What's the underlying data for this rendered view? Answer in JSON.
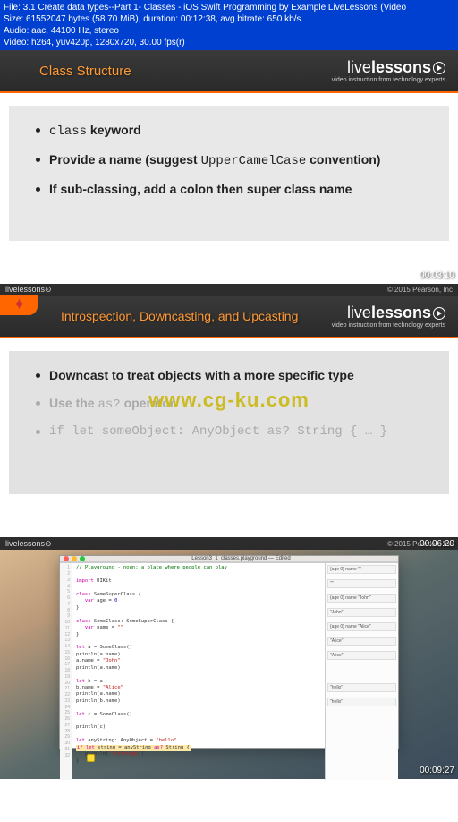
{
  "metadata": {
    "file": "File: 3.1 Create data types--Part 1- Classes - iOS Swift Programming by Example LiveLessons (Video",
    "size": "Size: 61552047 bytes (58.70 MiB), duration: 00:12:38, avg.bitrate: 650 kb/s",
    "audio": "Audio: aac, 44100 Hz, stereo",
    "video": "Video: h264, yuv420p, 1280x720, 30.00 fps(r)"
  },
  "brand": {
    "live": "live",
    "lessons": "lessons",
    "tagline": "video instruction from technology experts"
  },
  "slide1": {
    "title": "Class Structure",
    "bullets": [
      {
        "pre": "",
        "code": "class",
        "post": " keyword"
      },
      {
        "pre": "Provide a name (suggest ",
        "code": "UpperCamelCase",
        "post": " convention)"
      },
      {
        "pre": "If sub-classing, add a colon then super class name",
        "code": "",
        "post": ""
      }
    ]
  },
  "strip2": {
    "copyright": "© 2015 Pearson, Inc",
    "timestamp": "00:03:10"
  },
  "slide2": {
    "title": "Introspection, Downcasting, and Upcasting",
    "bullets": [
      {
        "text": "Downcast to treat objects with a more specific type",
        "gray": false
      },
      {
        "text_pre": "Use the ",
        "code": "as?",
        "text_post": " operator",
        "gray": true
      },
      {
        "code_full": "if let someObject: AnyObject as? String { … }",
        "gray": true
      }
    ],
    "watermark": "www.cg-ku.com"
  },
  "strip3": {
    "copyright": "© 2015 Pearson, Inc",
    "timestamp": "00:06:20"
  },
  "screenshot": {
    "window_title": "Lesson3_1_classes.playground — Edited",
    "timestamp": "00:09:27",
    "line_numbers": "1\n2\n3\n4\n5\n6\n7\n8\n9\n10\n11\n12\n13\n14\n15\n16\n17\n18\n19\n20\n21\n22\n23\n24\n25\n26\n27\n28\n29\n30\n31\n32",
    "code_comment": "// Playground - noun: a place where people can play",
    "code_import": "import",
    "code_uikit": " UIKit",
    "code_l1": "class",
    "code_l1b": " SomeSuperClass {",
    "code_l2": "   var",
    "code_l2b": " age = ",
    "code_l2c": "0",
    "code_l3": "}",
    "code_l4": "class",
    "code_l4b": " SomeClass: SomeSuperClass {",
    "code_l5": "   var",
    "code_l5b": " name = ",
    "code_l5c": "\"\"",
    "code_l6": "}",
    "code_l7": "let",
    "code_l7b": " a = SomeClass()",
    "code_l8": "println(a.name)",
    "code_l9": "a.name = ",
    "code_l9b": "\"John\"",
    "code_l10": "println(a.name)",
    "code_l11": "let",
    "code_l11b": " b = a",
    "code_l12": "b.name = ",
    "code_l12b": "\"Alice\"",
    "code_l13": "println(a.name)",
    "code_l14": "println(b.name)",
    "code_l15": "let",
    "code_l15b": " c = SomeClass()",
    "code_l16": "println(c)",
    "code_l17": "let",
    "code_l17b": " anyString: AnyObject = ",
    "code_l17c": "\"hello\"",
    "code_l18a": "if let",
    "code_l18b": " string = anyString ",
    "code_l18c": "as?",
    "code_l18d": " String {",
    "code_l19": "   println(",
    "code_l19b": "\"\\(string)\"",
    "code_l19c": ")",
    "code_l20": "}",
    "results": [
      "{age 0} name \"\"",
      "\"\"",
      "{age 0} name \"John\"",
      "\"John\"",
      "{age 0} name \"Alice\"",
      "\"Alice\"",
      "\"Alice\"",
      "\"hello\"",
      "\"hello\""
    ]
  }
}
